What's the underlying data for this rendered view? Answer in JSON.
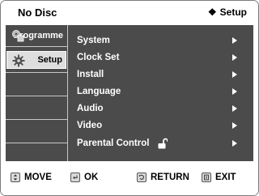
{
  "header": {
    "disc_status": "No Disc",
    "current_menu": "Setup",
    "current_menu_icon": "setup-icon"
  },
  "sidebar": {
    "tabs": [
      {
        "label": "Programme",
        "icon": "programme-icon",
        "selected": false
      },
      {
        "label": "Setup",
        "icon": "setup-gear-icon",
        "selected": true
      }
    ]
  },
  "menu": {
    "items": [
      {
        "label": "System",
        "has_submenu": true
      },
      {
        "label": "Clock Set",
        "has_submenu": true
      },
      {
        "label": "Install",
        "has_submenu": true
      },
      {
        "label": "Language",
        "has_submenu": true
      },
      {
        "label": "Audio",
        "has_submenu": true
      },
      {
        "label": "Video",
        "has_submenu": true
      },
      {
        "label": "Parental Control",
        "has_submenu": true,
        "icon": "unlocked-padlock-icon"
      }
    ]
  },
  "footer": {
    "move_label": "MOVE",
    "ok_label": "OK",
    "return_label": "RETURN",
    "exit_label": "EXIT"
  },
  "colors": {
    "menu_background": "#4b4b4b",
    "selected_tab_background": "#dedede",
    "menu_text": "#ffffff",
    "bar_background": "#ffffff"
  }
}
